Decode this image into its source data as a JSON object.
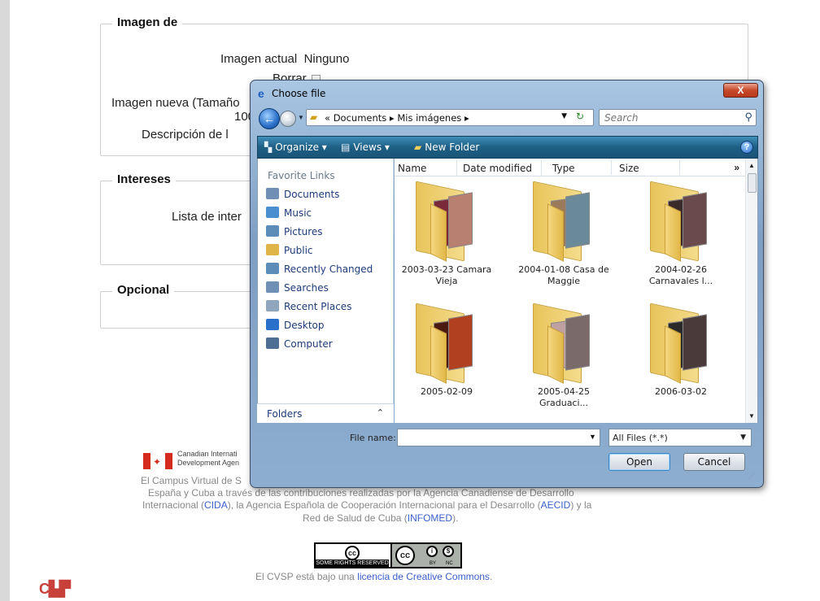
{
  "page": {
    "section_image": {
      "legend": "Imagen de",
      "current_image_label": "Imagen actual",
      "current_image_value": "Ninguno",
      "delete_label": "Borrar",
      "new_image_label": "Imagen nueva (Tamaño",
      "new_image_size_fragment": "100",
      "description_label": "Descripción de l"
    },
    "section_interests": {
      "legend": "Intereses",
      "list_label": "Lista de inter"
    },
    "section_optional": {
      "legend": "Opcional"
    },
    "footer": {
      "cida_line1": "Canadian Internati",
      "cida_line2": "Development Agen",
      "para_line1": "El Campus Virtual de S",
      "para_line2": "España y Cuba a través de las contribuciones realizadas por la Agencia Canadiense de Desarrollo",
      "para_line3_prefix": "Internacional (",
      "cida_link": "CIDA",
      "para_line3_mid": "), la Agencia Española de Cooperación Internacional para el Desarrollo (",
      "aecid_link": "AECID",
      "para_line3_suffix": ") y la",
      "para_line4_prefix": "Red de Salud de Cuba (",
      "infomed_link": "INFOMED",
      "para_line4_suffix": ").",
      "cc_badge_text": "SOME RIGHTS RESERVED",
      "cc_by": "BY",
      "cc_nc": "NC",
      "license_prefix": "El CVSP está bajo una ",
      "license_link": "licencia de Creative Commons",
      "license_suffix": "."
    }
  },
  "dialog": {
    "title": "Choose file",
    "close_label": "X",
    "address": {
      "path": "« Documents ▸ Mis imágenes ▸"
    },
    "search": {
      "placeholder": "Search"
    },
    "toolbar": {
      "organize": "Organize ▾",
      "views": "Views ▾",
      "new_folder": "New Folder",
      "help": "?"
    },
    "nav": {
      "heading": "Favorite Links",
      "items": [
        {
          "label": "Documents",
          "icon": "documents-icon",
          "color": "#6f8fb5"
        },
        {
          "label": "Music",
          "icon": "music-icon",
          "color": "#4a8fd0"
        },
        {
          "label": "Pictures",
          "icon": "pictures-icon",
          "color": "#5c8db8"
        },
        {
          "label": "Public",
          "icon": "public-icon",
          "color": "#e0b547"
        },
        {
          "label": "Recently Changed",
          "icon": "recently-changed-icon",
          "color": "#5c8db8"
        },
        {
          "label": "Searches",
          "icon": "searches-icon",
          "color": "#6f8fb5"
        },
        {
          "label": "Recent Places",
          "icon": "recent-places-icon",
          "color": "#8fa6bd"
        },
        {
          "label": "Desktop",
          "icon": "desktop-icon",
          "color": "#2a6fc9"
        },
        {
          "label": "Computer",
          "icon": "computer-icon",
          "color": "#4d6f94"
        }
      ],
      "folders_label": "Folders"
    },
    "columns": [
      "Name",
      "Date modified",
      "Type",
      "Size"
    ],
    "more_columns": "»",
    "folders": [
      {
        "label": "2003-03-23 Camara Vieja",
        "photo_a": "#7a2a3a",
        "photo_b": "#b88070"
      },
      {
        "label": "2004-01-08 Casa de Maggie",
        "photo_a": "#9a7a5a",
        "photo_b": "#6a8a9a"
      },
      {
        "label": "2004-02-26 Carnavales l...",
        "photo_a": "#3a2a2a",
        "photo_b": "#6a4a4a"
      },
      {
        "label": "2005-02-09",
        "photo_a": "#4a1a10",
        "photo_b": "#b04020"
      },
      {
        "label": "2005-04-25 Graduaci...",
        "photo_a": "#c0a0a0",
        "photo_b": "#7a6a6a"
      },
      {
        "label": "2006-03-02",
        "photo_a": "#2a2a2a",
        "photo_b": "#4a3a3a"
      }
    ],
    "file_name_label": "File name:",
    "file_name_value": "",
    "file_type": "All Files (*.*)",
    "open_label": "Open",
    "cancel_label": "Cancel"
  }
}
